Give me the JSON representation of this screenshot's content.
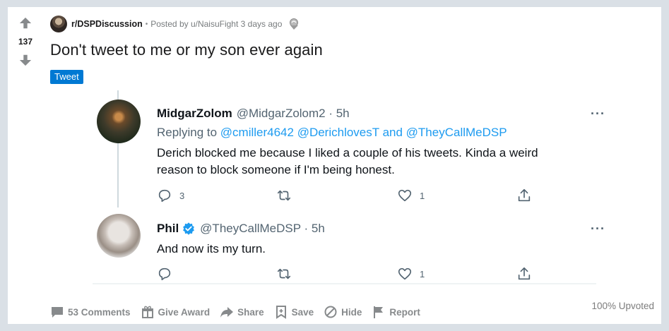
{
  "post": {
    "score": "137",
    "subreddit": "r/DSPDiscussion",
    "posted_by": "Posted by u/NaisuFight 3 days ago",
    "title": "Don't tweet to me or my son ever again",
    "flair": "Tweet",
    "upvoted": "100% Upvoted"
  },
  "tweets": [
    {
      "name": "MidgarZolom",
      "handle": "@MidgarZolom2 · 5h",
      "replying_prefix": "Replying to ",
      "replying_mentions": "@cmiller4642 @DerichlovesT",
      "replying_and": " and ",
      "replying_last": "@TheyCallMeDSP",
      "text_line1": "Derich blocked me because I liked a couple of his tweets. Kinda a weird",
      "text_line2": "reason to block someone if I'm being honest.",
      "reply_count": "3",
      "retweet_count": "",
      "like_count": "1"
    },
    {
      "name": "Phil",
      "handle": "@TheyCallMeDSP · 5h",
      "text_line1": "And now its my turn.",
      "reply_count": "",
      "retweet_count": "",
      "like_count": "1"
    }
  ],
  "footer": {
    "comments": "53 Comments",
    "give_award": "Give Award",
    "share": "Share",
    "save": "Save",
    "hide": "Hide",
    "report": "Report"
  },
  "colors": {
    "page_bg": "#dae0e6",
    "flair_bg": "#0079d3",
    "mention": "#1d9bf0",
    "verified": "#1d9bf0"
  },
  "icons": [
    "upvote-icon",
    "downvote-icon",
    "award-icon",
    "more-icon",
    "reply-icon",
    "retweet-icon",
    "like-icon",
    "share-icon",
    "verified-icon",
    "comment-icon",
    "gift-icon",
    "share-arrow-icon",
    "save-icon",
    "hide-icon",
    "report-icon"
  ]
}
